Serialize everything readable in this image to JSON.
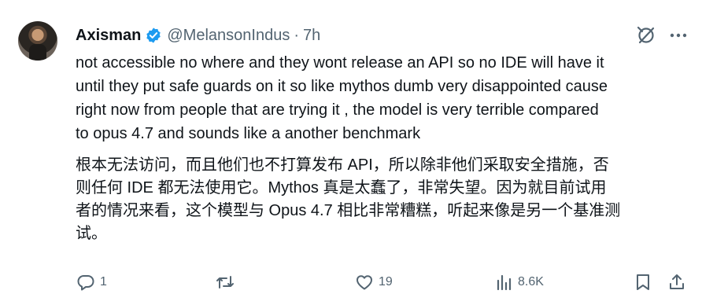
{
  "tweet": {
    "author_name": "Axisman",
    "handle": "@MelansonIndus",
    "separator": "·",
    "time": "7h",
    "text_lines": [
      "not accessible no where and they wont release an API so no IDE will have it",
      "until they put safe guards on it so like mythos dumb very disappointed cause",
      "right now from people that are trying it , the model is very terrible compared",
      "to opus 4.7 and sounds like a another benchmark"
    ],
    "translation_lines": [
      "根本无法访问，而且他们也不打算发布 API，所以除非他们采取安全措施，否",
      "则任何 IDE 都无法使用它。Mythos 真是太蠢了，非常失望。因为就目前试用",
      "者的情况来看，这个模型与 Opus 4.7 相比非常糟糕，听起来像是另一个基准测",
      "试。"
    ]
  },
  "actions": {
    "reply_count": "1",
    "repost_count": "",
    "like_count": "19",
    "views_count": "8.6K"
  },
  "colors": {
    "text": "#0f1419",
    "secondary": "#536471",
    "verified": "#1d9bf0"
  },
  "icons": {
    "verified": "verified-badge-icon",
    "grok": "grok-icon",
    "more": "more-icon",
    "reply": "reply-icon",
    "repost": "repost-icon",
    "like": "like-icon",
    "views": "views-icon",
    "bookmark": "bookmark-icon",
    "share": "share-icon"
  }
}
